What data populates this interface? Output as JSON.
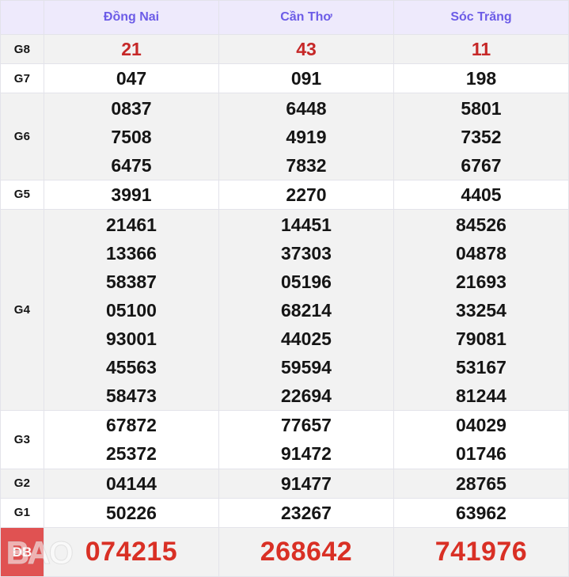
{
  "table": {
    "corner_label": "",
    "provinces": [
      "Đồng Nai",
      "Cần Thơ",
      "Sóc Trăng"
    ],
    "header_bg": "#eeeafc",
    "header_color": "#6c5ce7",
    "rows": [
      {
        "prize": "G8",
        "color": "#c62828",
        "shaded": true,
        "values": [
          [
            "21"
          ],
          [
            "43"
          ],
          [
            "11"
          ]
        ]
      },
      {
        "prize": "G7",
        "color": "#151515",
        "shaded": false,
        "values": [
          [
            "047"
          ],
          [
            "091"
          ],
          [
            "198"
          ]
        ]
      },
      {
        "prize": "G6",
        "color": "#151515",
        "shaded": true,
        "values": [
          [
            "0837",
            "7508",
            "6475"
          ],
          [
            "6448",
            "4919",
            "7832"
          ],
          [
            "5801",
            "7352",
            "6767"
          ]
        ]
      },
      {
        "prize": "G5",
        "color": "#151515",
        "shaded": false,
        "values": [
          [
            "3991"
          ],
          [
            "2270"
          ],
          [
            "4405"
          ]
        ]
      },
      {
        "prize": "G4",
        "color": "#151515",
        "shaded": true,
        "values": [
          [
            "21461",
            "13366",
            "58387",
            "05100",
            "93001",
            "45563",
            "58473"
          ],
          [
            "14451",
            "37303",
            "05196",
            "68214",
            "44025",
            "59594",
            "22694"
          ],
          [
            "84526",
            "04878",
            "21693",
            "33254",
            "79081",
            "53167",
            "81244"
          ]
        ]
      },
      {
        "prize": "G3",
        "color": "#151515",
        "shaded": false,
        "values": [
          [
            "67872",
            "25372"
          ],
          [
            "77657",
            "91472"
          ],
          [
            "04029",
            "01746"
          ]
        ]
      },
      {
        "prize": "G2",
        "color": "#151515",
        "shaded": true,
        "values": [
          [
            "04144"
          ],
          [
            "91477"
          ],
          [
            "28765"
          ]
        ]
      },
      {
        "prize": "G1",
        "color": "#151515",
        "shaded": false,
        "values": [
          [
            "50226"
          ],
          [
            "23267"
          ],
          [
            "63962"
          ]
        ]
      }
    ],
    "special": {
      "prize": "DB",
      "label_bg": "#e05252",
      "label_color": "#ffffff",
      "number_color": "#d93025",
      "values": [
        "074215",
        "268642",
        "741976"
      ]
    },
    "watermark": "BAO"
  }
}
